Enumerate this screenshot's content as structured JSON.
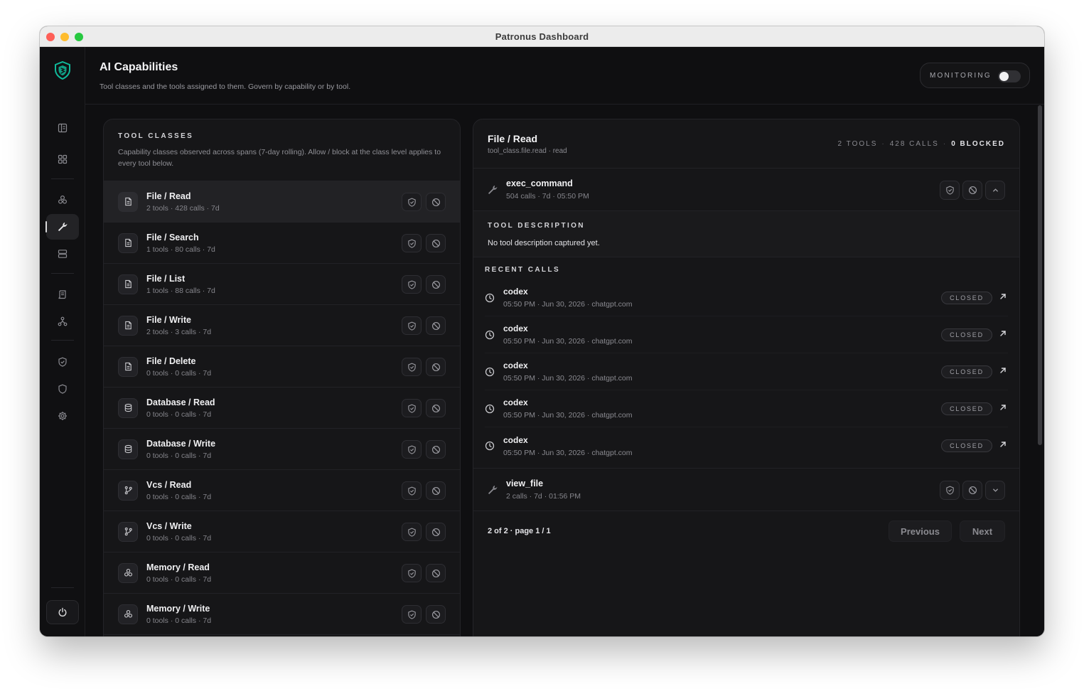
{
  "window": {
    "title": "Patronus Dashboard"
  },
  "header": {
    "title": "AI Capabilities",
    "subtitle": "Tool classes and the tools assigned to them. Govern by capability or by tool.",
    "monitoring_label": "MONITORING",
    "monitoring_on": false
  },
  "colors": {
    "brand": "#10b99a",
    "background": "#0f0f11",
    "panel": "#161618"
  },
  "rail": {
    "items": [
      {
        "icon": "layout-icon"
      },
      {
        "icon": "grid-icon"
      },
      {
        "icon": "capabilities-icon"
      },
      {
        "icon": "wrench-icon",
        "active": true
      },
      {
        "icon": "server-icon"
      },
      {
        "icon": "scroll-icon"
      },
      {
        "icon": "network-icon"
      },
      {
        "icon": "shield-check-icon"
      },
      {
        "icon": "shield-icon"
      },
      {
        "icon": "gear-icon"
      }
    ],
    "power_icon": "power-icon"
  },
  "tool_classes": {
    "heading": "TOOL CLASSES",
    "description": "Capability classes observed across spans (7-day rolling). Allow / block at the class level applies to every tool below.",
    "items": [
      {
        "name": "File / Read",
        "meta": "2 tools · 428 calls · 7d",
        "icon": "file-icon",
        "selected": true
      },
      {
        "name": "File / Search",
        "meta": "1 tools · 80 calls · 7d",
        "icon": "file-icon"
      },
      {
        "name": "File / List",
        "meta": "1 tools · 88 calls · 7d",
        "icon": "file-icon"
      },
      {
        "name": "File / Write",
        "meta": "2 tools · 3 calls · 7d",
        "icon": "file-icon"
      },
      {
        "name": "File / Delete",
        "meta": "0 tools · 0 calls · 7d",
        "icon": "file-icon"
      },
      {
        "name": "Database / Read",
        "meta": "0 tools · 0 calls · 7d",
        "icon": "database-icon"
      },
      {
        "name": "Database / Write",
        "meta": "0 tools · 0 calls · 7d",
        "icon": "database-icon"
      },
      {
        "name": "Vcs / Read",
        "meta": "0 tools · 0 calls · 7d",
        "icon": "git-branch-icon"
      },
      {
        "name": "Vcs / Write",
        "meta": "0 tools · 0 calls · 7d",
        "icon": "git-branch-icon"
      },
      {
        "name": "Memory / Read",
        "meta": "0 tools · 0 calls · 7d",
        "icon": "memory-icon"
      },
      {
        "name": "Memory / Write",
        "meta": "0 tools · 0 calls · 7d",
        "icon": "memory-icon"
      }
    ]
  },
  "detail": {
    "title": "File / Read",
    "subtitle": "tool_class.file.read · read",
    "stats": {
      "tools": "2 TOOLS",
      "calls": "428 CALLS",
      "blocked": "0 BLOCKED"
    },
    "tools": [
      {
        "name": "exec_command",
        "meta": "504 calls · 7d · 05:50 PM",
        "expanded": true
      },
      {
        "name": "view_file",
        "meta": "2 calls · 7d · 01:56 PM",
        "expanded": false
      }
    ],
    "tool_description": {
      "heading": "TOOL DESCRIPTION",
      "text": "No tool description captured yet."
    },
    "recent_calls": {
      "heading": "RECENT CALLS",
      "items": [
        {
          "name": "codex",
          "meta": "05:50 PM · Jun 30, 2026 · chatgpt.com",
          "status": "CLOSED"
        },
        {
          "name": "codex",
          "meta": "05:50 PM · Jun 30, 2026 · chatgpt.com",
          "status": "CLOSED"
        },
        {
          "name": "codex",
          "meta": "05:50 PM · Jun 30, 2026 · chatgpt.com",
          "status": "CLOSED"
        },
        {
          "name": "codex",
          "meta": "05:50 PM · Jun 30, 2026 · chatgpt.com",
          "status": "CLOSED"
        },
        {
          "name": "codex",
          "meta": "05:50 PM · Jun 30, 2026 · chatgpt.com",
          "status": "CLOSED"
        }
      ]
    },
    "pagination": {
      "info": "2 of 2 · page 1 / 1",
      "previous": "Previous",
      "next": "Next"
    }
  }
}
